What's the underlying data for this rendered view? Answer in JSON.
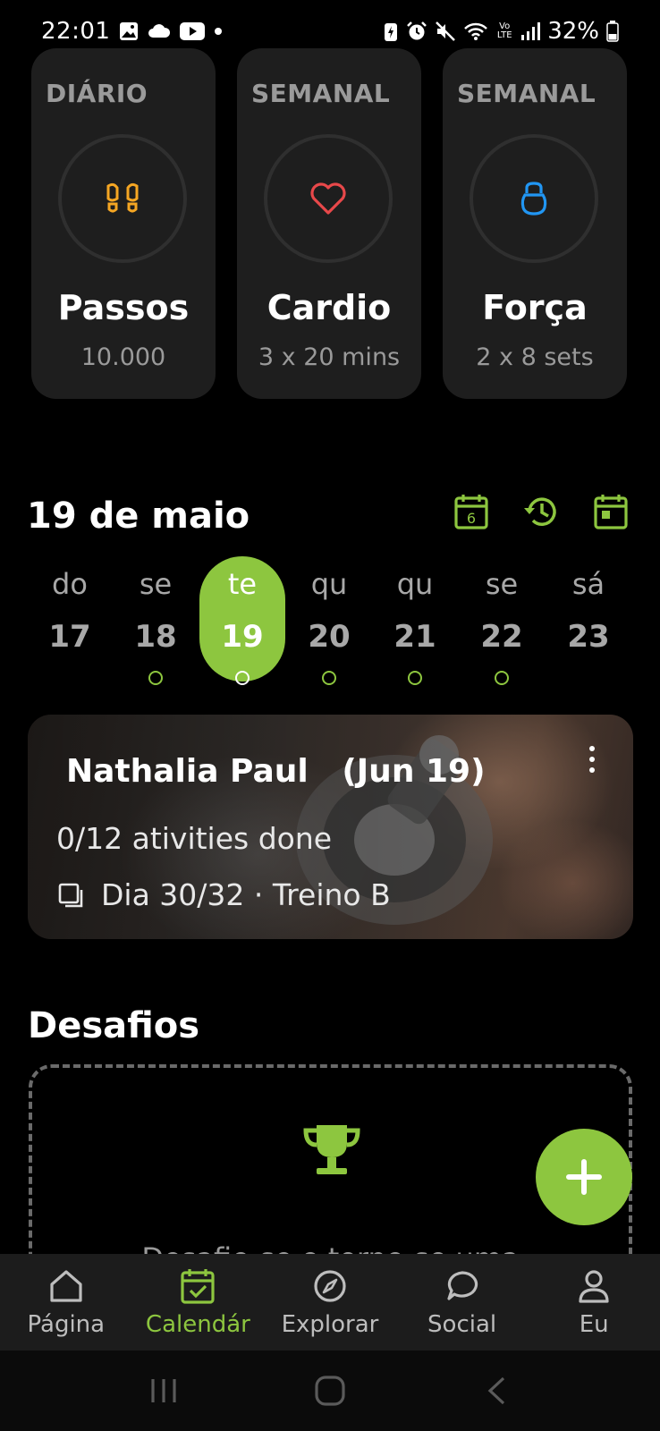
{
  "status_bar": {
    "time": "22:01",
    "battery": "32%",
    "left_icons": [
      "image-icon",
      "cloud-icon",
      "youtube-icon",
      "dot-icon"
    ],
    "right_icons": [
      "battery-saver-icon",
      "alarm-icon",
      "mute-icon",
      "wifi-icon",
      "volte-icon",
      "signal-icon",
      "battery-icon"
    ],
    "volte": "Vo LTE"
  },
  "goals": [
    {
      "period": "DIÁRIO",
      "title": "Passos",
      "value": "10.000",
      "icon": "footsteps-icon",
      "color": "#f5a623"
    },
    {
      "period": "SEMANAL",
      "title": "Cardio",
      "value": "3 x 20 mins",
      "icon": "heart-icon",
      "color": "#e8484a"
    },
    {
      "period": "SEMANAL",
      "title": "Força",
      "value": "2 x 8 sets",
      "icon": "kettlebell-icon",
      "color": "#2196f3"
    }
  ],
  "calendar": {
    "date_title": "19 de maio",
    "badge_number": "6",
    "actions": [
      "calendar-six-icon",
      "history-icon",
      "today-icon"
    ],
    "days": [
      {
        "label": "do",
        "number": "17",
        "dot": false,
        "selected": false
      },
      {
        "label": "se",
        "number": "18",
        "dot": true,
        "selected": false
      },
      {
        "label": "te",
        "number": "19",
        "dot": true,
        "selected": true
      },
      {
        "label": "qu",
        "number": "20",
        "dot": true,
        "selected": false
      },
      {
        "label": "qu",
        "number": "21",
        "dot": true,
        "selected": false
      },
      {
        "label": "se",
        "number": "22",
        "dot": true,
        "selected": false
      },
      {
        "label": "sá",
        "number": "23",
        "dot": false,
        "selected": false
      }
    ]
  },
  "workout": {
    "title": "Nathalia Paul   (Jun 19)",
    "progress": "0/12 ativities done",
    "plan": "Dia 30/32 · Treino B"
  },
  "challenges": {
    "title": "Desafios",
    "text": "Desafie-se e torne-se uma"
  },
  "bottom_nav": [
    {
      "label": "Página",
      "icon": "home-icon",
      "active": false
    },
    {
      "label": "Calendár",
      "icon": "calendar-check-icon",
      "active": true
    },
    {
      "label": "Explorar",
      "icon": "compass-icon",
      "active": false
    },
    {
      "label": "Social",
      "icon": "chat-bubble-icon",
      "active": false
    },
    {
      "label": "Eu",
      "icon": "person-icon",
      "active": false
    }
  ],
  "colors": {
    "accent": "#8dc63f",
    "card": "#1e1e1e",
    "background": "#000000"
  }
}
